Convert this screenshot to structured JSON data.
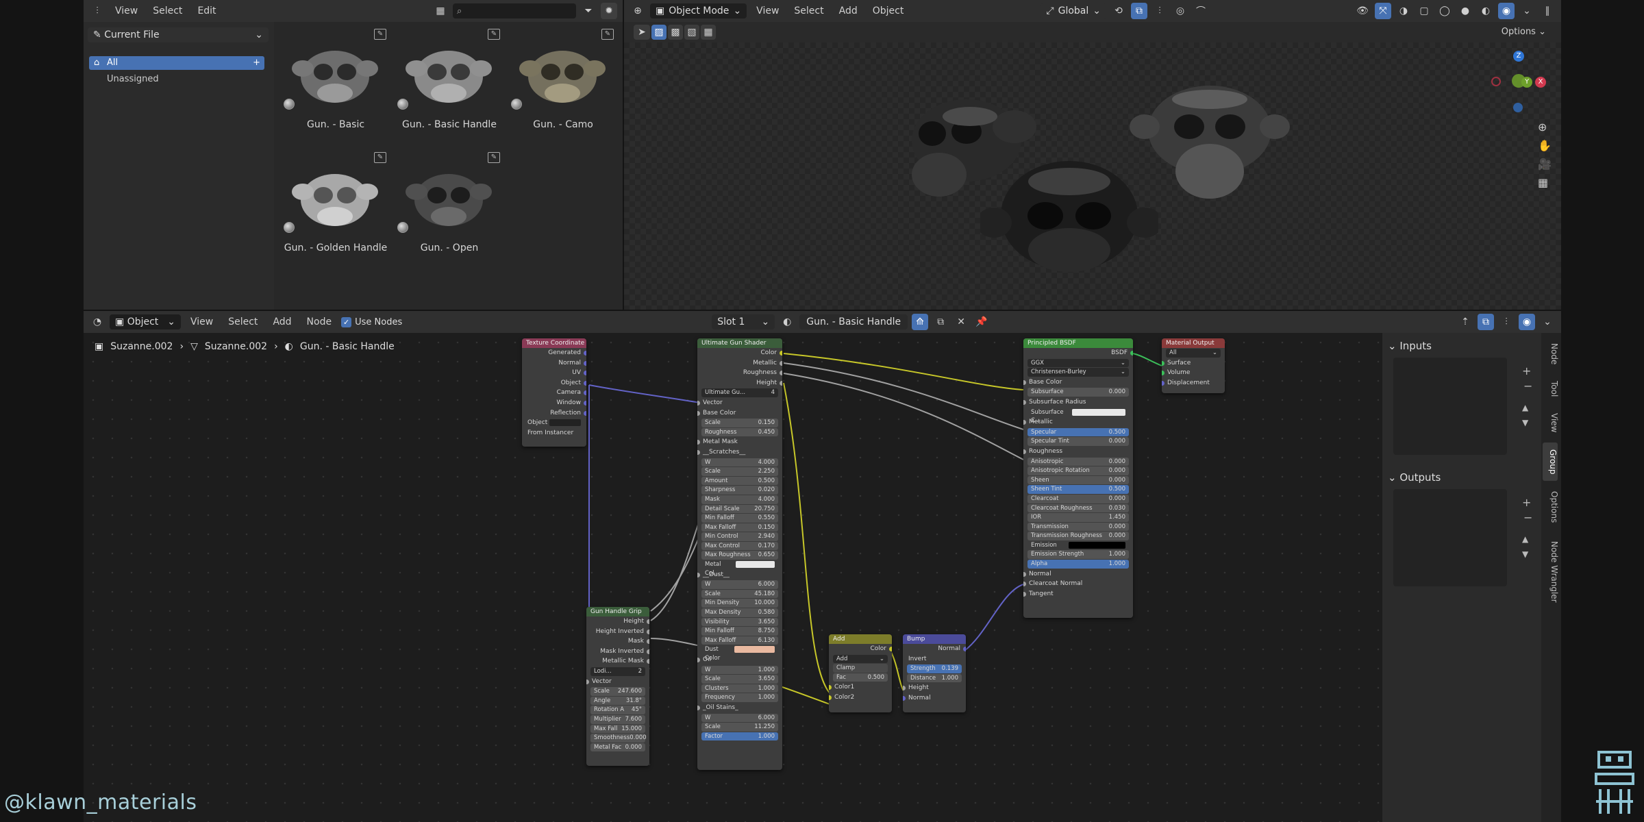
{
  "asset_browser": {
    "menu": [
      "View",
      "Select",
      "Edit"
    ],
    "library": "Current File",
    "catalogs": [
      {
        "label": "All",
        "selected": true
      },
      {
        "label": "Unassigned",
        "selected": false
      }
    ],
    "assets": [
      {
        "label": "Gun. - Basic",
        "tone": "#8a8a8a"
      },
      {
        "label": "Gun. - Basic Handle",
        "tone": "#9a9a9a"
      },
      {
        "label": "Gun. - Camo",
        "tone": "#7d7663"
      },
      {
        "label": "Gun. - Golden Handle",
        "tone": "#b3b3b3"
      },
      {
        "label": "Gun. - Open",
        "tone": "#4a4a4a"
      }
    ]
  },
  "viewport": {
    "mode": "Object Mode",
    "menu": [
      "View",
      "Select",
      "Add",
      "Object"
    ],
    "orientation": "Global",
    "options_label": "Options",
    "gizmo": {
      "z": "Z",
      "y": "Y",
      "x": "X"
    }
  },
  "node_editor": {
    "type": "Object",
    "menu": [
      "View",
      "Select",
      "Add",
      "Node"
    ],
    "use_nodes_label": "Use Nodes",
    "use_nodes": true,
    "slot": "Slot 1",
    "material": "Gun. - Basic Handle",
    "breadcrumb": [
      "Suzanne.002",
      "Suzanne.002",
      "Gun. - Basic Handle"
    ]
  },
  "nodes": {
    "texcoord": {
      "title": "Texture Coordinate",
      "outputs": [
        "Generated",
        "Normal",
        "UV",
        "Object",
        "Camera",
        "Window",
        "Reflection"
      ],
      "object_label": "Object",
      "from_instancer": "From Instancer"
    },
    "shader_group": {
      "title": "Ultimate Gun Shader",
      "outputs": [
        "Color",
        "Metallic",
        "Roughness",
        "Height"
      ],
      "group_name": "Ultimate Gu...",
      "users": "4",
      "rows": [
        {
          "t": "sock",
          "l": "Vector"
        },
        {
          "t": "sock",
          "l": "Base Color"
        },
        {
          "t": "fld",
          "l": "Scale",
          "v": "0.150"
        },
        {
          "t": "fld",
          "l": "Roughness",
          "v": "0.450"
        },
        {
          "t": "sock",
          "l": "Metal Mask"
        },
        {
          "t": "sock",
          "l": "__Scratches__"
        },
        {
          "t": "fld",
          "l": "W",
          "v": "4.000"
        },
        {
          "t": "fld",
          "l": "Scale",
          "v": "2.250"
        },
        {
          "t": "fld",
          "l": "Amount",
          "v": "0.500"
        },
        {
          "t": "fld",
          "l": "Sharpness",
          "v": "0.020"
        },
        {
          "t": "fld",
          "l": "Mask",
          "v": "4.000"
        },
        {
          "t": "fld",
          "l": "Detail Scale",
          "v": "20.750"
        },
        {
          "t": "fld",
          "l": "Min Falloff",
          "v": "0.550"
        },
        {
          "t": "fld",
          "l": "Max Falloff",
          "v": "0.150"
        },
        {
          "t": "fld",
          "l": "Min Control",
          "v": "2.940"
        },
        {
          "t": "fld",
          "l": "Max Control",
          "v": "0.170"
        },
        {
          "t": "fld",
          "l": "Max Roughness",
          "v": "0.650"
        },
        {
          "t": "col",
          "l": "Metal Col...",
          "c": "#e8e8e8"
        },
        {
          "t": "sock",
          "l": "__Dust__"
        },
        {
          "t": "fld",
          "l": "W",
          "v": "6.000"
        },
        {
          "t": "fld",
          "l": "Scale",
          "v": "45.180"
        },
        {
          "t": "fld",
          "l": "Min Density",
          "v": "10.000"
        },
        {
          "t": "fld",
          "l": "Max Density",
          "v": "0.580"
        },
        {
          "t": "fld",
          "l": "Visibility",
          "v": "3.650"
        },
        {
          "t": "fld",
          "l": "Min Falloff",
          "v": "8.750"
        },
        {
          "t": "fld",
          "l": "Max Falloff",
          "v": "6.130"
        },
        {
          "t": "col",
          "l": "Dust Color",
          "c": "#e9b9a0"
        },
        {
          "t": "sock",
          "l": "Oil"
        },
        {
          "t": "fld",
          "l": "W",
          "v": "1.000"
        },
        {
          "t": "fld",
          "l": "Scale",
          "v": "3.650"
        },
        {
          "t": "fld",
          "l": "Clusters",
          "v": "1.000"
        },
        {
          "t": "fld",
          "l": "Frequency",
          "v": "1.000"
        },
        {
          "t": "sock",
          "l": "_Oil Stains_"
        },
        {
          "t": "fld",
          "l": "W",
          "v": "6.000"
        },
        {
          "t": "fld",
          "l": "Scale",
          "v": "11.250"
        },
        {
          "t": "fldb",
          "l": "Factor",
          "v": "1.000"
        }
      ]
    },
    "grip": {
      "title": "Gun Handle Grip",
      "outputs": [
        "Height",
        "Height Inverted",
        "Mask",
        "Mask Inverted",
        "Metallic Mask"
      ],
      "group_name": "Lodi...",
      "users": "2",
      "rows": [
        {
          "t": "sock",
          "l": "Vector"
        },
        {
          "t": "fld",
          "l": "Scale",
          "v": "247.600"
        },
        {
          "t": "fld",
          "l": "Angle",
          "v": "31.8°"
        },
        {
          "t": "fld",
          "l": "Rotation A",
          "v": "45°"
        },
        {
          "t": "fld",
          "l": "Multiplier",
          "v": "7.600"
        },
        {
          "t": "fld",
          "l": "Max Fall",
          "v": "15.000"
        },
        {
          "t": "fld",
          "l": "Smoothness",
          "v": "0.000"
        },
        {
          "t": "fld",
          "l": "Metal Fac",
          "v": "0.000"
        }
      ]
    },
    "add": {
      "title": "Add",
      "output": "Color",
      "op": "Add",
      "clamp": "Clamp",
      "fac_label": "Fac",
      "fac": "0.500",
      "in1": "Color1",
      "in2": "Color2"
    },
    "bump": {
      "title": "Bump",
      "output": "Normal",
      "invert": "Invert",
      "strength_label": "Strength",
      "strength": "0.139",
      "distance_label": "Distance",
      "distance": "1.000",
      "in1": "Height",
      "in2": "Normal"
    },
    "bsdf": {
      "title": "Principled BSDF",
      "output": "BSDF",
      "dist": "GGX",
      "sss": "Christensen-Burley",
      "rows": [
        {
          "t": "sock",
          "l": "Base Color"
        },
        {
          "t": "fld",
          "l": "Subsurface",
          "v": "0.000"
        },
        {
          "t": "sock",
          "l": "Subsurface Radius"
        },
        {
          "t": "col",
          "l": "Subsurface C...",
          "c": "#e8e8e8"
        },
        {
          "t": "sock",
          "l": "Metallic"
        },
        {
          "t": "fldb",
          "l": "Specular",
          "v": "0.500"
        },
        {
          "t": "fld",
          "l": "Specular Tint",
          "v": "0.000"
        },
        {
          "t": "sock",
          "l": "Roughness"
        },
        {
          "t": "fld",
          "l": "Anisotropic",
          "v": "0.000"
        },
        {
          "t": "fld",
          "l": "Anisotropic Rotation",
          "v": "0.000"
        },
        {
          "t": "fld",
          "l": "Sheen",
          "v": "0.000"
        },
        {
          "t": "fldb",
          "l": "Sheen Tint",
          "v": "0.500"
        },
        {
          "t": "fld",
          "l": "Clearcoat",
          "v": "0.000"
        },
        {
          "t": "fld",
          "l": "Clearcoat Roughness",
          "v": "0.030"
        },
        {
          "t": "fld",
          "l": "IOR",
          "v": "1.450"
        },
        {
          "t": "fld",
          "l": "Transmission",
          "v": "0.000"
        },
        {
          "t": "fld",
          "l": "Transmission Roughness",
          "v": "0.000"
        },
        {
          "t": "col",
          "l": "Emission",
          "c": "#000000"
        },
        {
          "t": "fld",
          "l": "Emission Strength",
          "v": "1.000"
        },
        {
          "t": "fldb",
          "l": "Alpha",
          "v": "1.000"
        },
        {
          "t": "sock",
          "l": "Normal"
        },
        {
          "t": "sock",
          "l": "Clearcoat Normal"
        },
        {
          "t": "sock",
          "l": "Tangent"
        }
      ]
    },
    "output": {
      "title": "Material Output",
      "target": "All",
      "inputs": [
        "Surface",
        "Volume",
        "Displacement"
      ]
    }
  },
  "sidebar": {
    "inputs_label": "Inputs",
    "outputs_label": "Outputs",
    "tabs": [
      "Node",
      "Tool",
      "View",
      "Group",
      "Options",
      "Node Wrangler"
    ],
    "active_tab": "Group"
  },
  "watermark": "@klawn_materials",
  "colors": {
    "accent": "#4772b3",
    "header_bg": "#303030",
    "node_wire_yellow": "#c7c729",
    "node_wire_purple": "#6363c7"
  }
}
